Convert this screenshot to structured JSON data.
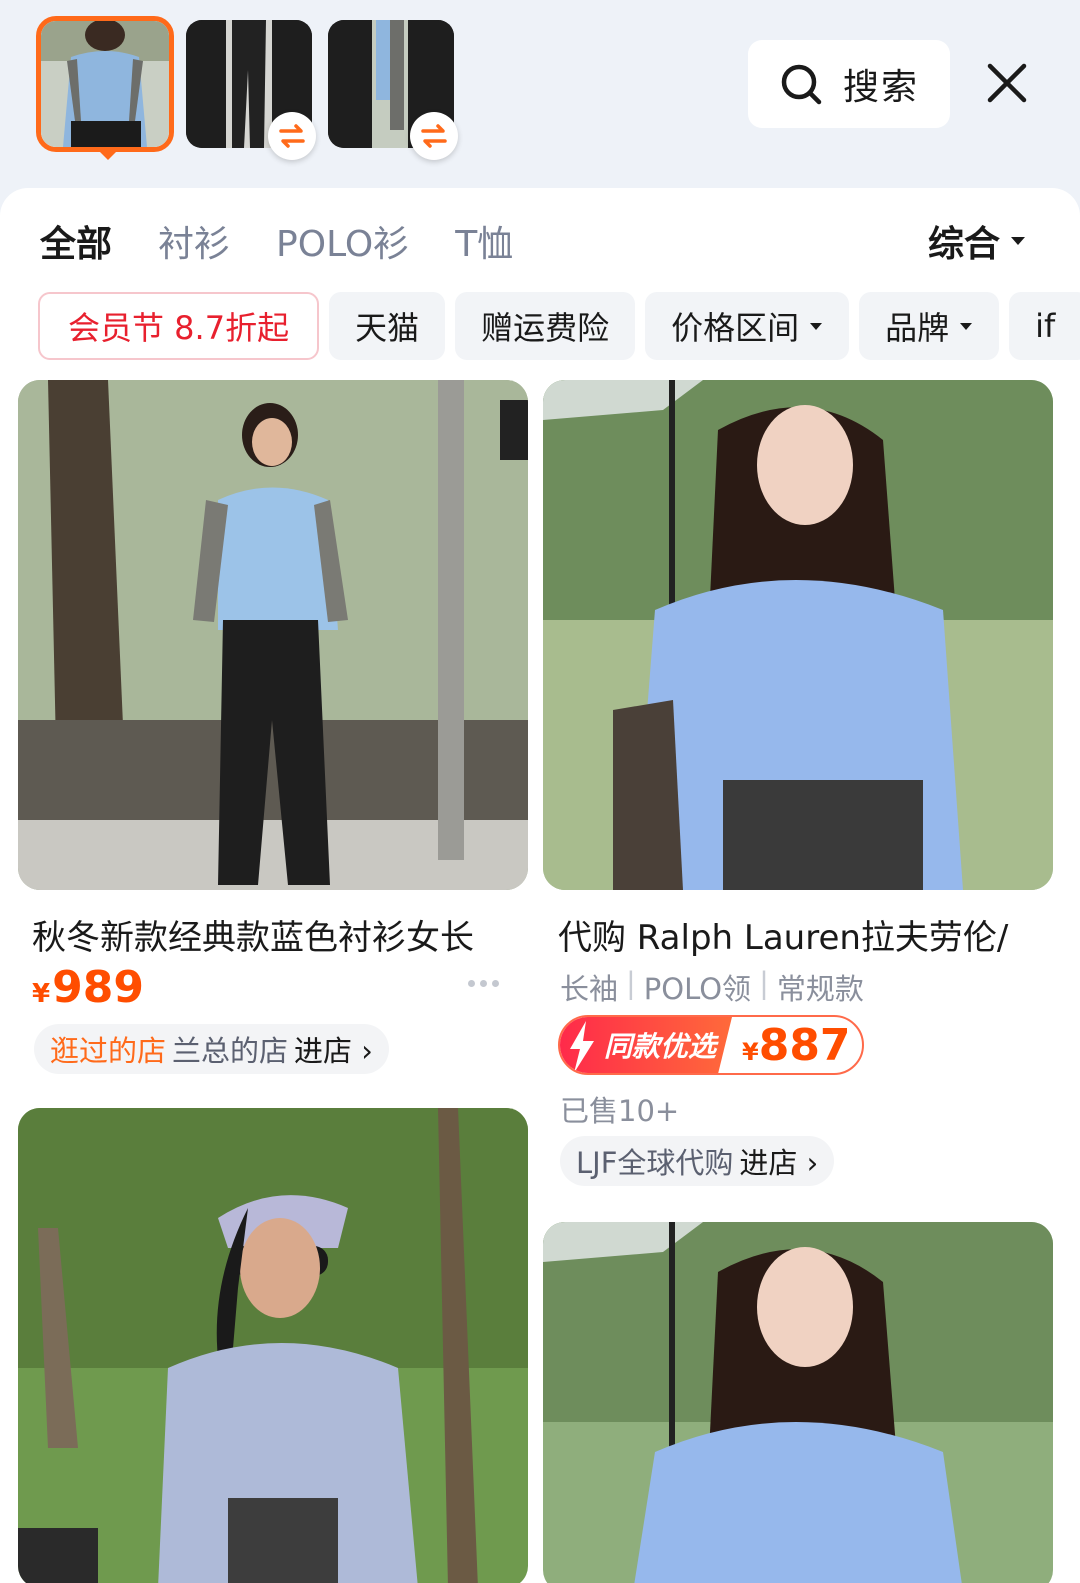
{
  "header": {
    "search_label": "搜索",
    "thumbnails": [
      {
        "name": "woman in blue shirt (selected)"
      },
      {
        "name": "black trousers crop"
      },
      {
        "name": "gray cardigan crop"
      }
    ]
  },
  "tabs": [
    "全部",
    "衬衫",
    "POLO衫",
    "T恤"
  ],
  "sort_label": "综合",
  "filters": {
    "promo": "会员节 8.7折起",
    "tmall": "天猫",
    "shipping_insurance": "赠运费险",
    "price_range": "价格区间",
    "brand": "品牌",
    "cut_off": "if"
  },
  "products": [
    {
      "title": "秋冬新款经典款蓝色衬衫女长",
      "currency": "¥",
      "price": "989",
      "visited_label": "逛过的店",
      "shop": "兰总的店",
      "enter_label": "进店 ›"
    },
    {
      "title": "代购 Ralph Lauren拉夫劳伦/",
      "attributes": [
        "长袖",
        "POLO领",
        "常规款"
      ],
      "deal_label": "同款优选",
      "currency": "¥",
      "price": "887",
      "sold": "已售10+",
      "shop": "LJF全球代购",
      "enter_label": "进店 ›"
    }
  ],
  "colors": {
    "accent_orange": "#ff6a1a",
    "price": "#ff4d00",
    "promo_red": "#e8202e",
    "background": "#eef2f8"
  }
}
